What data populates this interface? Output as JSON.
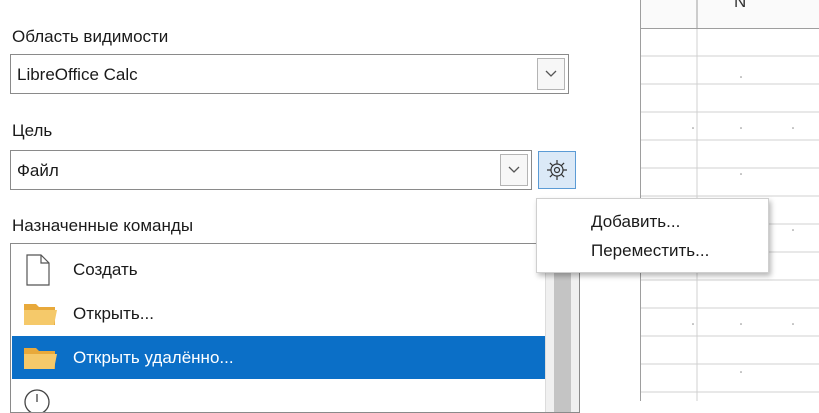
{
  "scope": {
    "label": "Область видимости",
    "value": "LibreOffice Calc"
  },
  "target": {
    "label": "Цель",
    "value": "Файл"
  },
  "commands": {
    "label": "Назначенные команды",
    "items": [
      {
        "label": "Создать",
        "icon": "new-document-icon",
        "selected": false
      },
      {
        "label": "Открыть...",
        "icon": "folder-icon",
        "selected": false
      },
      {
        "label": "Открыть удалённо...",
        "icon": "folder-icon",
        "selected": true
      }
    ]
  },
  "context_menu": {
    "items": [
      "Добавить...",
      "Переместить..."
    ]
  },
  "spreadsheet": {
    "column": "N"
  },
  "colors": {
    "selection": "#0b6fc7",
    "gear_button_bg": "#dbe9f7"
  }
}
